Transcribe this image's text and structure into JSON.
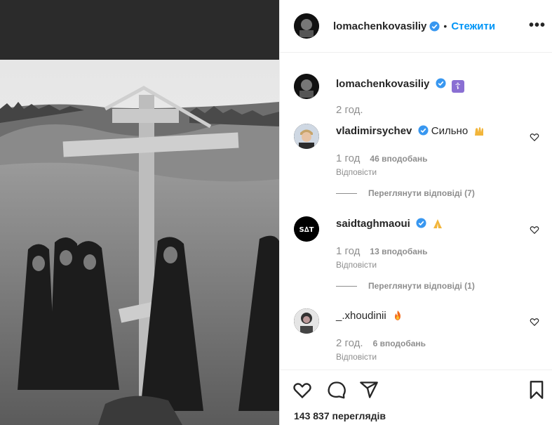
{
  "post": {
    "author": "lomachenkovasiliy",
    "follow_label": "Стежити",
    "separator": "•",
    "more_label": "•••",
    "caption_emoji": "☦",
    "caption_time": "2 год.",
    "views_text": "143 837 переглядів"
  },
  "comments": [
    {
      "username": "vladimirsychev",
      "verified": true,
      "text": "Сильно",
      "time": "1 год",
      "likes": "46 вподобань",
      "reply_label": "Відповісти",
      "view_replies": "Переглянути відповіді (7)"
    },
    {
      "username": "saidtaghmaoui",
      "verified": true,
      "text": "",
      "time": "1 год",
      "likes": "13 вподобань",
      "reply_label": "Відповісти",
      "view_replies": "Переглянути відповіді (1)"
    },
    {
      "username": "_.xhoudinii",
      "verified": false,
      "text": "",
      "time": "2 год.",
      "likes": "6 вподобань",
      "reply_label": "Відповісти"
    }
  ],
  "icons": {
    "verified": "verified-badge-icon",
    "like": "heart-icon",
    "comment": "comment-icon",
    "share": "share-icon",
    "save": "bookmark-icon",
    "more": "more-options-icon"
  },
  "colors": {
    "accent": "#0095f6",
    "text": "#262626",
    "muted": "#8e8e8e",
    "border": "#efefef"
  }
}
